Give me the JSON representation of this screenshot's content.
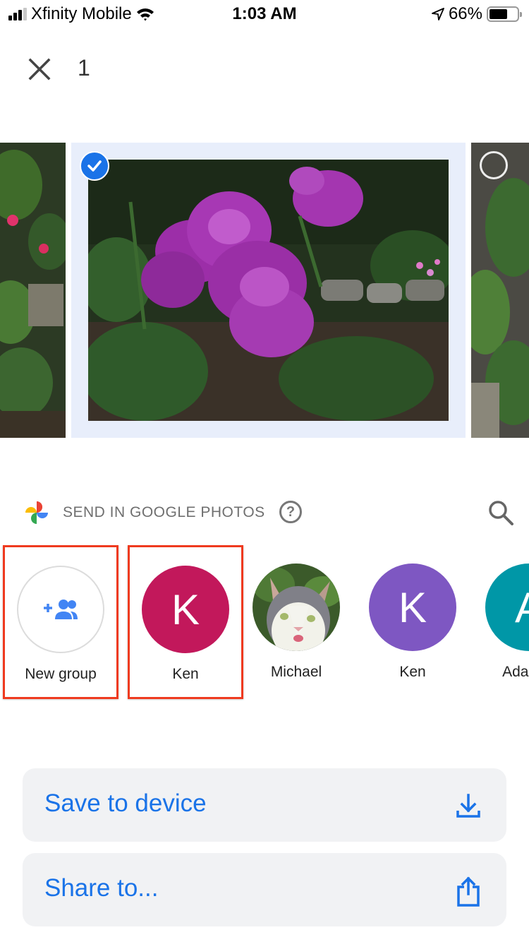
{
  "status_bar": {
    "carrier": "Xfinity Mobile",
    "time": "1:03 AM",
    "battery_percent": "66%",
    "battery_level": 0.66,
    "signal_bars_active": 3,
    "signal_bars_total": 4
  },
  "top_bar": {
    "selected_count": "1"
  },
  "carousel": {
    "photos": [
      {
        "name": "partial-left-photo",
        "selected": false
      },
      {
        "name": "purple-roses-photo",
        "selected": true
      },
      {
        "name": "partial-right-photo",
        "selected": false
      }
    ]
  },
  "send_section": {
    "title": "SEND IN GOOGLE PHOTOS",
    "help_glyph": "?"
  },
  "contacts": [
    {
      "name": "New group",
      "type": "new-group",
      "highlighted": true
    },
    {
      "name": "Ken",
      "initial": "K",
      "color": "#c2185b",
      "highlighted": true
    },
    {
      "name": "Michael",
      "type": "photo-avatar",
      "highlighted": false
    },
    {
      "name": "Ken",
      "initial": "K",
      "color": "#7e57c2",
      "highlighted": false
    },
    {
      "name": "Adam U",
      "initial": "A",
      "color": "#0097a7",
      "highlighted": false
    }
  ],
  "actions": {
    "save_label": "Save to device",
    "share_label": "Share to..."
  },
  "colors": {
    "accent": "#1a73e8",
    "highlight_box": "#ef3a1f",
    "action_bg": "#f1f2f4"
  }
}
